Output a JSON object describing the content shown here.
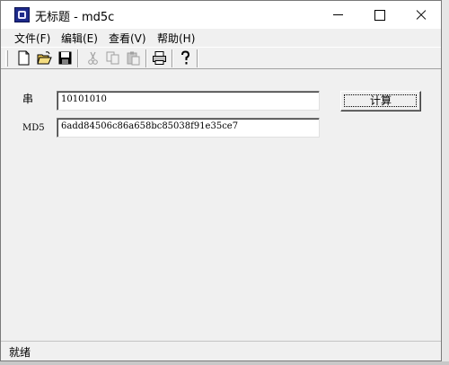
{
  "window": {
    "title": "无标题 - md5c"
  },
  "menu": [
    {
      "label": "文件(F)"
    },
    {
      "label": "编辑(E)"
    },
    {
      "label": "查看(V)"
    },
    {
      "label": "帮助(H)"
    }
  ],
  "toolbar": {
    "buttons": [
      "new-icon",
      "open-icon",
      "save-icon",
      "cut-icon",
      "copy-icon",
      "paste-icon",
      "print-icon",
      "help-icon"
    ]
  },
  "form": {
    "string_label": "串",
    "string_value": "10101010",
    "md5_label": "MD5",
    "md5_value": "6add84506c86a658bc85038f91e35ce7",
    "calc_button": "计算"
  },
  "status": {
    "text": "就绪"
  }
}
